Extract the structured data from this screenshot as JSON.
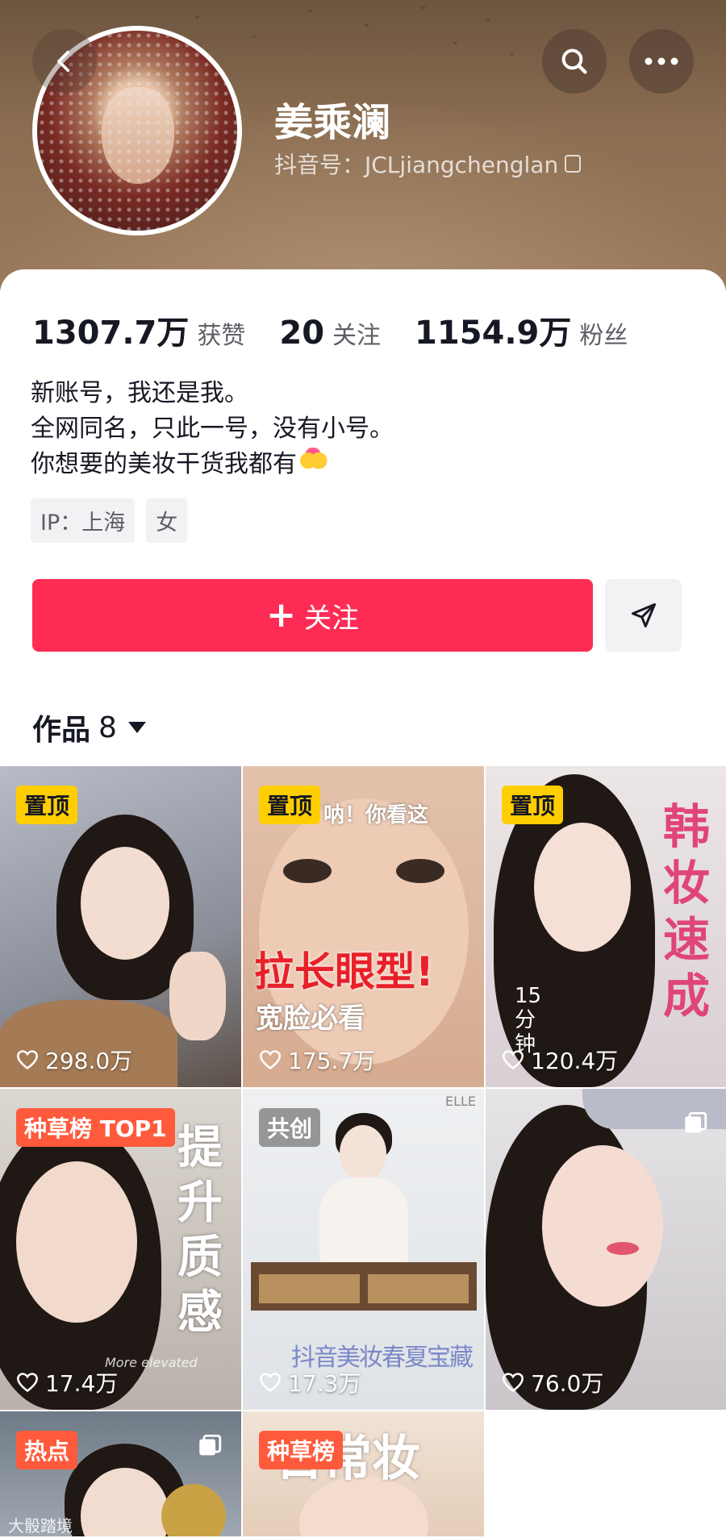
{
  "header": {
    "back_icon": "chevron-left-icon",
    "search_icon": "search-icon",
    "more_icon": "more-horizontal-icon"
  },
  "profile": {
    "name": "姜乘澜",
    "douyin_id": "抖音号：JCLjiangchenglan",
    "stats": [
      {
        "num": "1307.7万",
        "label": "获赞"
      },
      {
        "num": "20",
        "label": "关注"
      },
      {
        "num": "1154.9万",
        "label": "粉丝"
      }
    ],
    "bio": [
      "新账号，我还是我。",
      "全网同名，只此一号，没有小号。",
      "你想要的美妆干货我都有"
    ],
    "tags": [
      "IP：上海",
      "女"
    ]
  },
  "actions": {
    "follow_label": "关注",
    "follow_color": "#fe2c55"
  },
  "works": {
    "tab_label": "作品",
    "count": "8"
  },
  "tiles": [
    {
      "badge": "置顶",
      "likes": "298.0万",
      "overlay": ""
    },
    {
      "badge": "置顶",
      "likes": "175.7万",
      "overlay_top": "呐！你看这",
      "overlay": "拉长眼型!",
      "overlay_sub": "宽脸必看"
    },
    {
      "badge": "置顶",
      "likes": "120.4万",
      "overlay": "韩妆速成",
      "overlay_sub": "15分钟"
    },
    {
      "badge": "种草榜 TOP1",
      "likes": "17.4万",
      "overlay": "提升质感",
      "overlay_sub": "More elevated"
    },
    {
      "badge": "共创",
      "likes": "17.3万",
      "overlay": "抖音美妆春夏宝藏",
      "overlay_top": "ELLE"
    },
    {
      "badge": "",
      "likes": "76.0万",
      "overlay": ""
    },
    {
      "badge": "热点",
      "likes": "",
      "overlay": ""
    },
    {
      "badge": "种草榜",
      "likes": "",
      "overlay": "日常妆"
    }
  ],
  "watermark": "大骰踏境"
}
